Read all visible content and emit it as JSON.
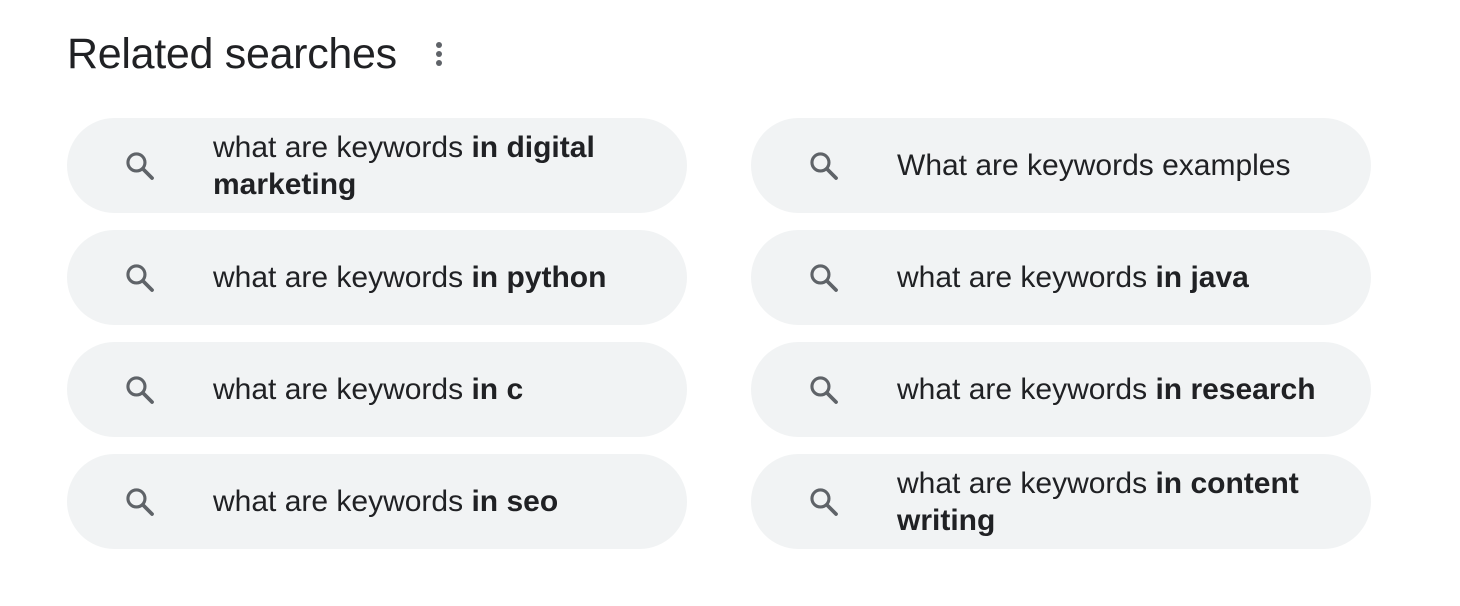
{
  "header": {
    "title": "Related searches",
    "more_icon": "more-vert-icon"
  },
  "chips": [
    {
      "plain": "what are keywords ",
      "bold": "in digital marketing",
      "icon": "search-icon"
    },
    {
      "plain": "What are keywords examples",
      "bold": "",
      "icon": "search-icon"
    },
    {
      "plain": "what are keywords ",
      "bold": "in python",
      "icon": "search-icon"
    },
    {
      "plain": "what are keywords ",
      "bold": "in java",
      "icon": "search-icon"
    },
    {
      "plain": "what are keywords ",
      "bold": "in c",
      "icon": "search-icon"
    },
    {
      "plain": "what are keywords ",
      "bold": "in research",
      "icon": "search-icon"
    },
    {
      "plain": "what are keywords ",
      "bold": "in seo",
      "icon": "search-icon"
    },
    {
      "plain": "what are keywords ",
      "bold": "in content writing",
      "icon": "search-icon"
    }
  ],
  "colors": {
    "chip_bg": "#f1f3f4",
    "text": "#202124",
    "icon": "#5f6368"
  }
}
